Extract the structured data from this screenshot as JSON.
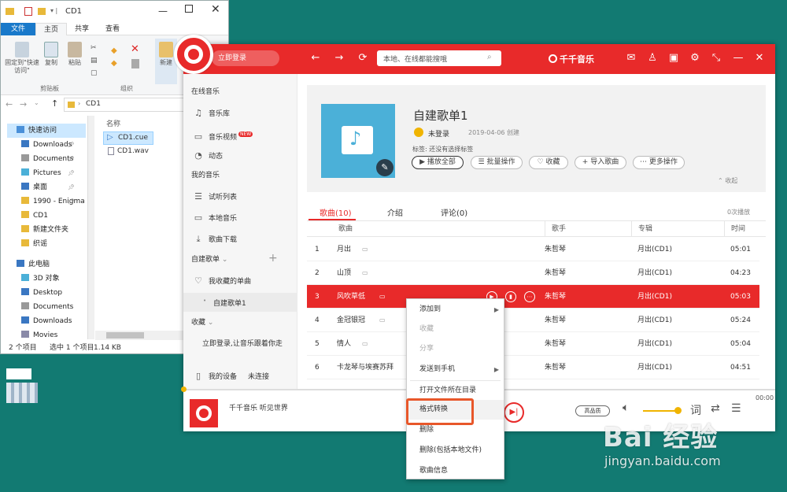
{
  "explorer": {
    "title": "CD1",
    "tabs": [
      "文件",
      "主页",
      "共享",
      "查看"
    ],
    "ribbon": {
      "pin_label": "固定到\"快速访问\"",
      "copy_label": "复制",
      "paste_label": "粘贴",
      "clipboard_group": "剪贴板",
      "organize_group": "组织",
      "new_label": "新建"
    },
    "address": "CD1",
    "nav": [
      {
        "label": "快速访问",
        "pin": false
      },
      {
        "label": "Downloads",
        "pin": true
      },
      {
        "label": "Documents",
        "pin": true
      },
      {
        "label": "Pictures",
        "pin": true
      },
      {
        "label": "桌面",
        "pin": true
      },
      {
        "label": "1990 - Enigma",
        "pin": true
      },
      {
        "label": "CD1",
        "pin": false
      },
      {
        "label": "新建文件夹",
        "pin": false
      },
      {
        "label": "织谣",
        "pin": false
      },
      {
        "label": "此电脑",
        "pin": false
      },
      {
        "label": "3D 对象",
        "pin": false
      },
      {
        "label": "Desktop",
        "pin": false
      },
      {
        "label": "Documents",
        "pin": false
      },
      {
        "label": "Downloads",
        "pin": false
      },
      {
        "label": "Movies",
        "pin": false
      }
    ],
    "column_name": "名称",
    "files": [
      "CD1.cue",
      "CD1.wav"
    ],
    "status": {
      "count": "2 个项目",
      "selected": "选中 1 个项目",
      "size": "1.14 KB"
    }
  },
  "qianqian": {
    "login": "立即登录",
    "search_placeholder": "本地、在线都能搜哦",
    "brand": "千千音乐",
    "sidebar": {
      "online_header": "在线音乐",
      "library": "音乐库",
      "mv": "音乐视频",
      "new_badge": "NEW",
      "feed": "动态",
      "my_header": "我的音乐",
      "trial": "试听列表",
      "local": "本地音乐",
      "download": "歌曲下载",
      "playlist_header": "自建歌单",
      "fav_playlist": "我收藏的单曲",
      "custom_playlist": "自建歌单1",
      "collect_header": "收藏",
      "login_tip": "立即登录,让音乐跟着你走",
      "device": "我的设备",
      "device_status": "未连接"
    },
    "playlist": {
      "title": "自建歌单1",
      "user": "未登录",
      "date": "2019-04-06 创建",
      "tags": "标签: 还没有选择标签",
      "play_all": "播放全部",
      "batch": "批量操作",
      "fav": "收藏",
      "import": "导入歌曲",
      "more": "更多操作",
      "collapse": "收起"
    },
    "tabs": [
      "歌曲(10)",
      "介绍",
      "评论(0)"
    ],
    "play_count": "0次播放",
    "columns": {
      "song": "歌曲",
      "artist": "歌手",
      "album": "专辑",
      "time": "时间"
    },
    "songs": [
      {
        "no": "1",
        "title": "月出",
        "artist": "朱哲琴",
        "album": "月出(CD1)",
        "time": "05:01"
      },
      {
        "no": "2",
        "title": "山顶",
        "artist": "朱哲琴",
        "album": "月出(CD1)",
        "time": "04:23"
      },
      {
        "no": "3",
        "title": "风吹草低",
        "artist": "朱哲琴",
        "album": "月出(CD1)",
        "time": "05:03"
      },
      {
        "no": "4",
        "title": "金冠银冠",
        "artist": "朱哲琴",
        "album": "月出(CD1)",
        "time": "05:24"
      },
      {
        "no": "5",
        "title": "情人",
        "artist": "朱哲琴",
        "album": "月出(CD1)",
        "time": "05:04"
      },
      {
        "no": "6",
        "title": "卡龙琴与埃赛苏拜",
        "artist": "朱哲琴",
        "album": "月出(CD1)",
        "time": "04:51"
      }
    ],
    "player": {
      "tagline": "千千音乐 听见世界",
      "time": "00:00",
      "quality": "高品质",
      "lyrics": "词"
    },
    "context_menu": [
      {
        "label": "添加到",
        "disabled": false,
        "submenu": true
      },
      {
        "label": "收藏",
        "disabled": true,
        "submenu": false
      },
      {
        "label": "分享",
        "disabled": true,
        "submenu": false
      },
      {
        "label": "发送到手机",
        "disabled": false,
        "submenu": true
      },
      {
        "label": "打开文件所在目录",
        "disabled": false,
        "submenu": false
      },
      {
        "label": "格式转换",
        "disabled": false,
        "submenu": false
      },
      {
        "label": "删除",
        "disabled": false,
        "submenu": false
      },
      {
        "label": "删除(包括本地文件)",
        "disabled": false,
        "submenu": false
      },
      {
        "label": "歌曲信息",
        "disabled": false,
        "submenu": false
      }
    ]
  },
  "watermark": {
    "logo": "Bai 经验",
    "url": "jingyan.baidu.com"
  },
  "colors": {
    "accent": "#e82a2a",
    "desktop": "#127a72",
    "highlight": "#e8572a"
  }
}
